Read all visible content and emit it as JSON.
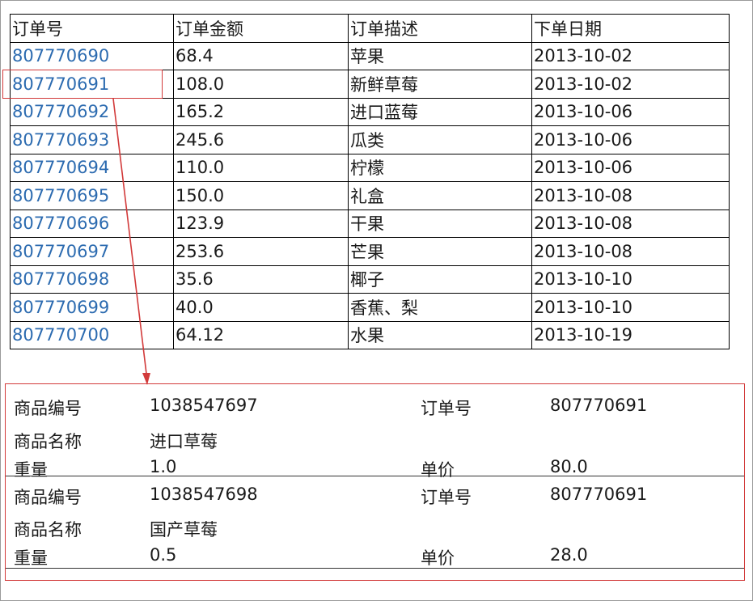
{
  "table": {
    "headers": [
      "订单号",
      "订单金额",
      "订单描述",
      "下单日期"
    ],
    "rows": [
      {
        "order_no": "807770690",
        "amount": "68.4",
        "desc": "苹果",
        "date": "2013-10-02"
      },
      {
        "order_no": "807770691",
        "amount": "108.0",
        "desc": "新鲜草莓",
        "date": "2013-10-02"
      },
      {
        "order_no": "807770692",
        "amount": "165.2",
        "desc": "进口蓝莓",
        "date": "2013-10-06"
      },
      {
        "order_no": "807770693",
        "amount": "245.6",
        "desc": "瓜类",
        "date": "2013-10-06"
      },
      {
        "order_no": "807770694",
        "amount": "110.0",
        "desc": "柠檬",
        "date": "2013-10-06"
      },
      {
        "order_no": "807770695",
        "amount": "150.0",
        "desc": "礼盒",
        "date": "2013-10-08"
      },
      {
        "order_no": "807770696",
        "amount": "123.9",
        "desc": "干果",
        "date": "2013-10-08"
      },
      {
        "order_no": "807770697",
        "amount": "253.6",
        "desc": "芒果",
        "date": "2013-10-08"
      },
      {
        "order_no": "807770698",
        "amount": "35.6",
        "desc": "椰子",
        "date": "2013-10-10"
      },
      {
        "order_no": "807770699",
        "amount": "40.0",
        "desc": "香蕉、梨",
        "date": "2013-10-10"
      },
      {
        "order_no": "807770700",
        "amount": "64.12",
        "desc": "水果",
        "date": "2013-10-19"
      }
    ]
  },
  "highlight_color": "#d23a3a",
  "link_color": "#2c6bb0",
  "detail": {
    "labels": {
      "product_id": "商品编号",
      "product_name": "商品名称",
      "weight": "重量",
      "order_no": "订单号",
      "unit_price": "单价"
    },
    "items": [
      {
        "product_id": "1038547697",
        "product_name": "进口草莓",
        "weight": "1.0",
        "order_no": "807770691",
        "unit_price": "80.0"
      },
      {
        "product_id": "1038547698",
        "product_name": "国产草莓",
        "weight": "0.5",
        "order_no": "807770691",
        "unit_price": "28.0"
      }
    ]
  }
}
